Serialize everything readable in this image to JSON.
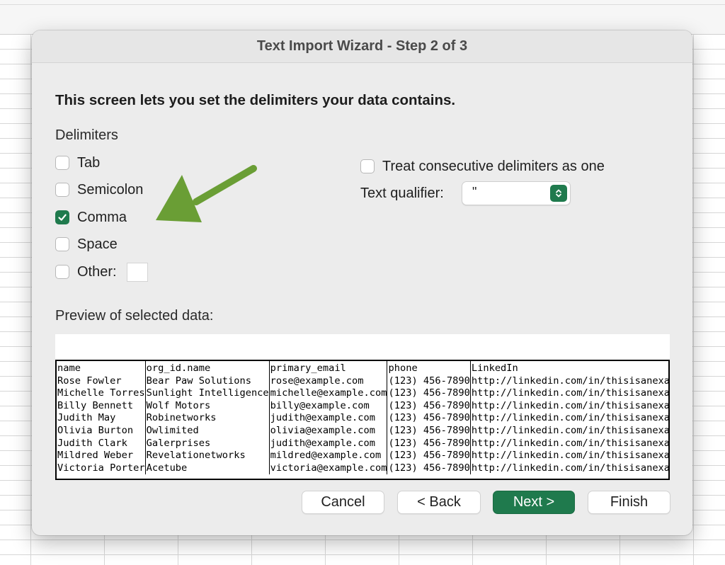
{
  "dialog": {
    "title": "Text Import Wizard - Step 2 of 3",
    "heading": "This screen lets you set the delimiters your data contains.",
    "delimiters_label": "Delimiters",
    "delimiters": [
      {
        "label": "Tab",
        "checked": false
      },
      {
        "label": "Semicolon",
        "checked": false
      },
      {
        "label": "Comma",
        "checked": true
      },
      {
        "label": "Space",
        "checked": false
      },
      {
        "label": "Other:",
        "checked": false,
        "value": ""
      }
    ],
    "treat_consecutive": {
      "label": "Treat consecutive delimiters as one",
      "checked": false
    },
    "text_qualifier": {
      "label": "Text qualifier:",
      "value": "\""
    },
    "preview_label": "Preview of selected data:",
    "preview": {
      "rows": [
        [
          "name",
          "org_id.name",
          "primary_email",
          "phone",
          "LinkedIn"
        ],
        [
          "Rose Fowler",
          "Bear Paw Solutions",
          "rose@example.com",
          "(123) 456-7890",
          "http://linkedin.com/in/thisisanexa"
        ],
        [
          "Michelle Torres",
          "Sunlight Intelligence",
          "michelle@example.com",
          "(123) 456-7890",
          "http://linkedin.com/in/thisisanexa"
        ],
        [
          "Billy Bennett",
          "Wolf Motors",
          "billy@example.com",
          "(123) 456-7890",
          "http://linkedin.com/in/thisisanexa"
        ],
        [
          "Judith May",
          "Robinetworks",
          "judith@example.com",
          "(123) 456-7890",
          "http://linkedin.com/in/thisisanexa"
        ],
        [
          "Olivia Burton",
          "Owlimited",
          "olivia@example.com",
          "(123) 456-7890",
          "http://linkedin.com/in/thisisanexa"
        ],
        [
          "Judith Clark",
          "Galerprises",
          "judith@example.com",
          "(123) 456-7890",
          "http://linkedin.com/in/thisisanexa"
        ],
        [
          "Mildred Weber",
          "Revelationetworks",
          "mildred@example.com",
          "(123) 456-7890",
          "http://linkedin.com/in/thisisanexa"
        ],
        [
          "Victoria Porter",
          "Acetube",
          "victoria@example.com",
          "(123) 456-7890",
          "http://linkedin.com/in/thisisanexa"
        ]
      ]
    },
    "buttons": {
      "cancel": "Cancel",
      "back": "< Back",
      "next": "Next >",
      "finish": "Finish"
    }
  },
  "colors": {
    "accent": "#1f7a4d",
    "arrow": "#6a9e35"
  },
  "icons": {
    "checkmark": "checkmark-icon",
    "stepper": "chevron-up-down-icon",
    "annotation": "arrow-icon"
  }
}
